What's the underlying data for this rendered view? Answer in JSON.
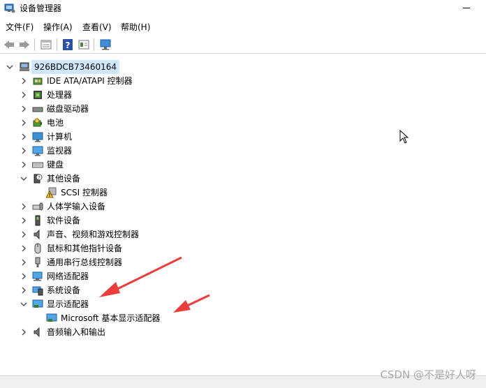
{
  "window": {
    "title": "设备管理器"
  },
  "menu": [
    {
      "label": "文件(F)"
    },
    {
      "label": "操作(A)"
    },
    {
      "label": "查看(V)"
    },
    {
      "label": "帮助(H)"
    }
  ],
  "toolbar": {
    "buttons": [
      "back-icon",
      "forward-icon",
      "properties-icon",
      "help-icon",
      "details-icon",
      "monitor-icon"
    ]
  },
  "tree": {
    "root": "926BDCB73460164",
    "categories": [
      {
        "label": "IDE ATA/ATAPI 控制器",
        "icon": "ide-controller-icon",
        "expanded": false
      },
      {
        "label": "处理器",
        "icon": "processor-icon",
        "expanded": false
      },
      {
        "label": "磁盘驱动器",
        "icon": "disk-drive-icon",
        "expanded": false
      },
      {
        "label": "电池",
        "icon": "battery-icon",
        "expanded": false
      },
      {
        "label": "计算机",
        "icon": "computer-icon",
        "expanded": false
      },
      {
        "label": "监视器",
        "icon": "monitor-icon",
        "expanded": false
      },
      {
        "label": "键盘",
        "icon": "keyboard-icon",
        "expanded": false
      },
      {
        "label": "其他设备",
        "icon": "other-devices-icon",
        "expanded": true,
        "children": [
          {
            "label": "SCSI 控制器",
            "icon": "warning-device-icon"
          }
        ]
      },
      {
        "label": "人体学输入设备",
        "icon": "hid-icon",
        "expanded": false
      },
      {
        "label": "软件设备",
        "icon": "software-device-icon",
        "expanded": false
      },
      {
        "label": "声音、视频和游戏控制器",
        "icon": "sound-icon",
        "expanded": false
      },
      {
        "label": "鼠标和其他指针设备",
        "icon": "mouse-icon",
        "expanded": false
      },
      {
        "label": "通用串行总线控制器",
        "icon": "usb-icon",
        "expanded": false
      },
      {
        "label": "网络适配器",
        "icon": "network-adapter-icon",
        "expanded": false
      },
      {
        "label": "系统设备",
        "icon": "system-device-icon",
        "expanded": false
      },
      {
        "label": "显示适配器",
        "icon": "display-adapter-icon",
        "expanded": true,
        "children": [
          {
            "label": "Microsoft 基本显示适配器",
            "icon": "display-adapter-icon"
          }
        ]
      },
      {
        "label": "音频输入和输出",
        "icon": "audio-icon",
        "expanded": false
      }
    ]
  },
  "watermark": "CSDN @不是好人呀",
  "annotation_color": "#ee3b3b"
}
